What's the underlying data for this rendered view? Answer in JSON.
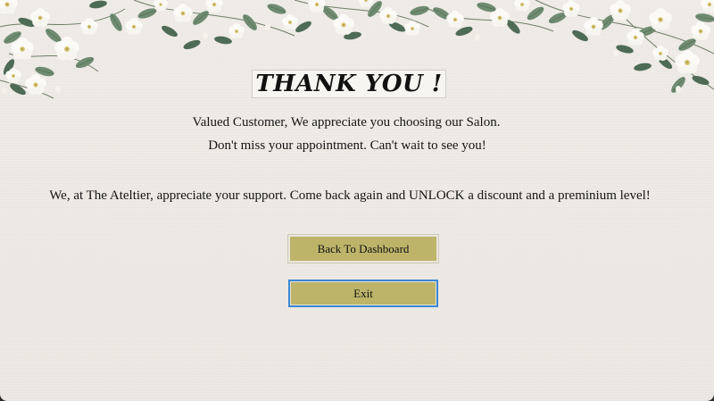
{
  "page": {
    "title": "THANK YOU !",
    "message_line1": "Valued Customer,  We appreciate you choosing our Salon.",
    "message_line2": "Don't miss your appointment. Can't wait to see you!",
    "message_line3": "We, at The Ateltier, appreciate your support. Come back again and UNLOCK a discount and a preminium level!"
  },
  "buttons": {
    "dashboard_label": "Back To Dashboard",
    "exit_label": "Exit"
  },
  "colors": {
    "background": "#ede9e4",
    "button_fill": "#bdb46a",
    "focus_border": "#3a86d4",
    "text": "#151515"
  },
  "decoration": {
    "top_border": "white-flower-vine"
  }
}
